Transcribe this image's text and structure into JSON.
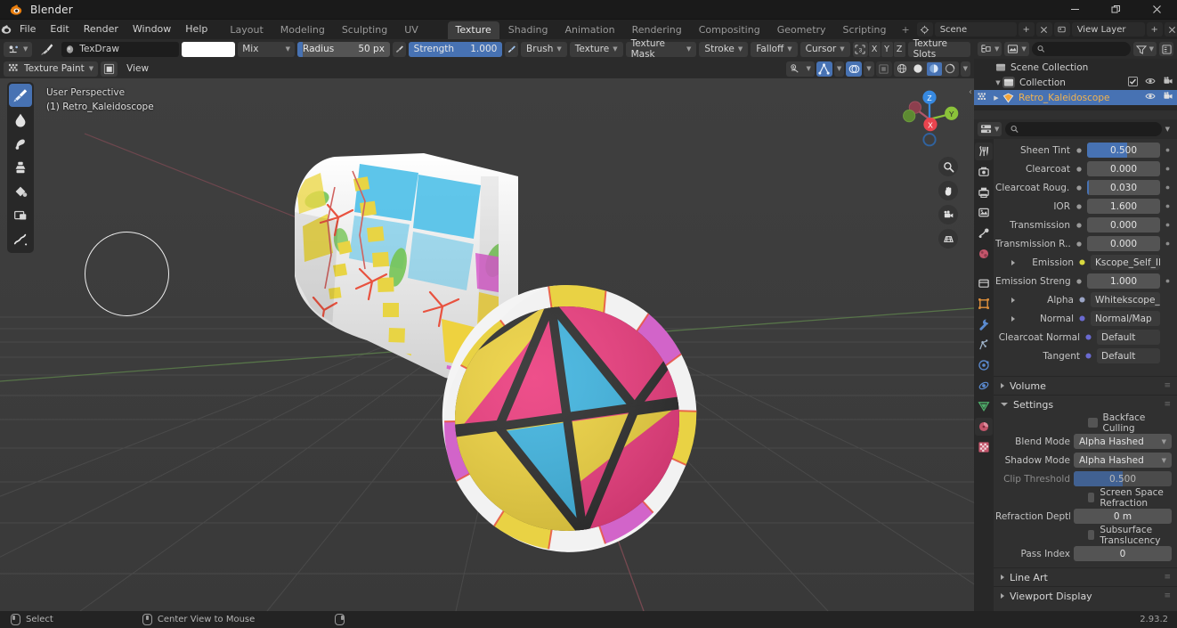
{
  "window": {
    "title": "Blender",
    "minimize": "—",
    "maximize": "❐",
    "close": "✕"
  },
  "menus": [
    "File",
    "Edit",
    "Render",
    "Window",
    "Help"
  ],
  "workspace_tabs": [
    {
      "label": "Layout",
      "active": false
    },
    {
      "label": "Modeling",
      "active": false
    },
    {
      "label": "Sculpting",
      "active": false
    },
    {
      "label": "UV Editing",
      "active": false
    },
    {
      "label": "Texture Paint",
      "active": true
    },
    {
      "label": "Shading",
      "active": false
    },
    {
      "label": "Animation",
      "active": false
    },
    {
      "label": "Rendering",
      "active": false
    },
    {
      "label": "Compositing",
      "active": false
    },
    {
      "label": "Geometry Nodes",
      "active": false
    },
    {
      "label": "Scripting",
      "active": false
    },
    {
      "label": "+",
      "active": false
    }
  ],
  "topbar_right": {
    "scene_icon": "scene-icon",
    "scene_name": "Scene",
    "viewlayer_icon": "viewlayer-icon",
    "viewlayer_name": "View Layer"
  },
  "tool_settings": {
    "brush_preset_icon": "brush-preset-icon",
    "brush_icon": "brush-icon",
    "brush_name": "TexDraw",
    "color_swatch": "#fefefe",
    "blend_mode": "Mix",
    "radius_label": "Radius",
    "radius_value": "50 px",
    "radius_fill_pct": 6,
    "strength_label": "Strength",
    "strength_value": "1.000",
    "strength_fill_pct": 100,
    "dropdowns": [
      "Brush",
      "Texture",
      "Texture Mask",
      "Stroke",
      "Falloff",
      "Cursor"
    ],
    "symmetry_label": "",
    "axis_buttons": [
      "X",
      "Y",
      "Z"
    ],
    "texture_slots": "Texture Slots"
  },
  "viewport_header": {
    "mode": "Texture Paint",
    "view_menu": "View",
    "object_icon": "object-mode-icon"
  },
  "viewport": {
    "perspective_label": "User Perspective",
    "object_label": "(1) Retro_Kaleidoscope",
    "gizmo_axes": [
      {
        "name": "Z",
        "color": "#3789e0"
      },
      {
        "name": "Y",
        "color": "#8bc33a"
      },
      {
        "name": "X",
        "color": "#e9444e"
      }
    ],
    "nav_buttons": [
      "zoom-icon",
      "hand-icon",
      "camera-icon",
      "ortho-icon"
    ],
    "collapse_icon": "chevron-left-icon"
  },
  "viewport_tools": [
    {
      "name": "draw-tool",
      "active": true
    },
    {
      "name": "soften-tool",
      "active": false
    },
    {
      "name": "smear-tool",
      "active": false
    },
    {
      "name": "clone-tool",
      "active": false
    },
    {
      "name": "fill-tool",
      "active": false
    },
    {
      "name": "mask-tool",
      "active": false
    },
    {
      "name": "annotate-tool",
      "active": false
    }
  ],
  "outliner": {
    "display_mode_icon": "view-layer-icon",
    "filter_icon": "filter-icon",
    "search_placeholder": "",
    "rows": [
      {
        "label": "Scene Collection",
        "indent": 14,
        "icon": "collection-icon",
        "selected": false,
        "disclosure": "",
        "icons": []
      },
      {
        "label": "Collection",
        "indent": 24,
        "icon": "collection-icon",
        "selected": false,
        "disclosure": "▼",
        "icons": [
          "checkbox",
          "eye",
          "camera"
        ]
      },
      {
        "label": "Retro_Kaleidoscope",
        "indent": 38,
        "icon": "mesh-icon",
        "selected": true,
        "disclosure": "▶",
        "icons": [
          "eye",
          "camera"
        ]
      }
    ]
  },
  "properties": {
    "editor_icon": "properties-icon",
    "search_placeholder": "",
    "tabs": [
      {
        "name": "tool-tab",
        "glyph": "⚒",
        "color": "#d0d0d0",
        "active": true
      },
      {
        "name": "render-tab",
        "glyph": "▣",
        "color": "#d0d0d0",
        "active": false
      },
      {
        "name": "output-tab",
        "glyph": "⎙",
        "color": "#d0d0d0",
        "active": false
      },
      {
        "name": "view-layer-tab",
        "glyph": "◰",
        "color": "#d0d0d0",
        "active": false
      },
      {
        "name": "scene-tab",
        "glyph": "◔",
        "color": "#d0d0d0",
        "active": false
      },
      {
        "name": "world-tab",
        "glyph": "●",
        "color": "#c3566b",
        "active": false
      },
      {
        "name": "collection-tab",
        "glyph": "☐",
        "color": "#d0d0d0",
        "active": false
      },
      {
        "name": "object-tab",
        "glyph": "▧",
        "color": "#e2923c",
        "active": false
      },
      {
        "name": "modifier-tab",
        "glyph": "ὒ7",
        "color": "#5b8bd0",
        "active": false
      },
      {
        "name": "particles-tab",
        "glyph": "⁂",
        "color": "#9fb3c9",
        "active": false
      },
      {
        "name": "physics-tab",
        "glyph": "◌",
        "color": "#5b8bd0",
        "active": false
      },
      {
        "name": "constraints-tab",
        "glyph": "⊚",
        "color": "#5b8bd0",
        "active": false
      },
      {
        "name": "data-tab",
        "glyph": "▽",
        "color": "#4fae6a",
        "active": false
      },
      {
        "name": "material-tab",
        "glyph": "◕",
        "color": "#c3566b",
        "active": true
      },
      {
        "name": "texture-tab",
        "glyph": "▒",
        "color": "#c3566b",
        "active": false
      }
    ],
    "fields": [
      {
        "label": "Sheen Tint",
        "type": "slider",
        "value": "0.500",
        "fill": 55,
        "anim": true,
        "dot": true
      },
      {
        "label": "Clearcoat",
        "type": "slider",
        "value": "0.000",
        "fill": 0,
        "anim": true,
        "dot": true
      },
      {
        "label": "Clearcoat Roug...",
        "type": "slider",
        "value": "0.030",
        "fill": 3,
        "anim": true,
        "dot": true
      },
      {
        "label": "IOR",
        "type": "slider",
        "value": "1.600",
        "fill": 0,
        "anim": true,
        "dot": true
      },
      {
        "label": "Transmission",
        "type": "slider",
        "value": "0.000",
        "fill": 0,
        "anim": true,
        "dot": true
      },
      {
        "label": "Transmission R...",
        "type": "slider",
        "value": "0.000",
        "fill": 0,
        "anim": true,
        "dot": true
      },
      {
        "label": "Emission",
        "type": "link",
        "value": "Kscope_Self_Ilum.png",
        "dotcolor": "#d9d93f",
        "expand": true,
        "anim": false,
        "dot": true
      },
      {
        "label": "Emission Streng...",
        "type": "slider",
        "value": "1.000",
        "fill": 0,
        "anim": true,
        "dot": true
      },
      {
        "label": "Alpha",
        "type": "link",
        "value": "Whitekscope_Refrac...",
        "dotcolor": "#9aa4c4",
        "expand": true,
        "anim": false,
        "dot": false
      },
      {
        "label": "Normal",
        "type": "link",
        "value": "Normal/Map",
        "dotcolor": "#6a6ad0",
        "expand": true,
        "anim": false,
        "dot": false
      },
      {
        "label": "Clearcoat Normal",
        "type": "link",
        "value": "Default",
        "dotcolor": "#6a6ad0",
        "expand": false,
        "anim": false,
        "dot": false
      },
      {
        "label": "Tangent",
        "type": "link",
        "value": "Default",
        "dotcolor": "#6a6ad0",
        "expand": false,
        "anim": false,
        "dot": false
      }
    ],
    "panels": [
      {
        "label": "Volume",
        "open": false
      },
      {
        "label": "Settings",
        "open": true
      }
    ],
    "settings": {
      "backface_culling": {
        "label": "Backface Culling",
        "checked": false
      },
      "blend_mode": {
        "label": "Blend Mode",
        "value": "Alpha Hashed"
      },
      "shadow_mode": {
        "label": "Shadow Mode",
        "value": "Alpha Hashed"
      },
      "clip_threshold": {
        "label": "Clip Threshold",
        "value": "0.500",
        "fill": 50
      },
      "screen_space_refraction": {
        "label": "Screen Space Refraction",
        "checked": false
      },
      "refraction_depth": {
        "label": "Refraction Depth",
        "value": "0 m"
      },
      "subsurface_translucency": {
        "label": "Subsurface Translucency",
        "checked": false
      },
      "pass_index": {
        "label": "Pass Index",
        "value": "0"
      }
    },
    "bottom_panels": [
      {
        "label": "Line Art",
        "open": false
      },
      {
        "label": "Viewport Display",
        "open": false
      }
    ]
  },
  "statusbar": {
    "items": [
      {
        "icon": "mouse-left-icon",
        "label": "Select"
      },
      {
        "icon": "mouse-middle-icon",
        "label": "Center View to Mouse"
      },
      {
        "icon": "mouse-right-icon",
        "label": ""
      }
    ],
    "version": "2.93.2"
  },
  "colors": {
    "accent_blue": "#4772b3",
    "yellow": "#f0d43c",
    "pink": "#ec3c7e",
    "cyan": "#40b8e3",
    "magenta": "#d760d0",
    "green": "#6ec05a",
    "red_line": "#e84a3a",
    "outliner_selected_text": "#f3b34e"
  }
}
